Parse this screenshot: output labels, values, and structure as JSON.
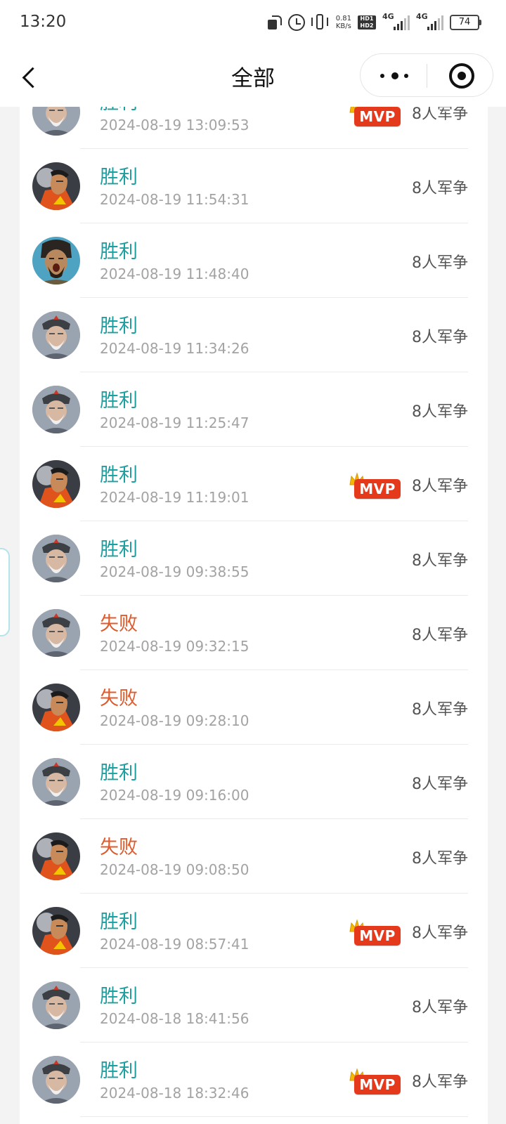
{
  "status_bar": {
    "time": "13:20",
    "net_speed": "0.81",
    "net_speed_unit": "KB/s",
    "hd_label_1": "HD1",
    "hd_label_2": "HD2",
    "network_1": "4G",
    "network_2": "4G",
    "battery": "74"
  },
  "nav": {
    "title": "全部",
    "back_icon": "chevron-left-icon",
    "more_icon": "more-dots-icon",
    "close_icon": "target-icon"
  },
  "mvp_label": "MVP",
  "records": [
    {
      "result": "胜利",
      "outcome": "win",
      "time": "2024-08-19 13:09:53",
      "mvp": true,
      "mode": "8人军争",
      "avatar": "old-general"
    },
    {
      "result": "胜利",
      "outcome": "win",
      "time": "2024-08-19 11:54:31",
      "mvp": false,
      "mode": "8人军争",
      "avatar": "red-armor-general"
    },
    {
      "result": "胜利",
      "outcome": "win",
      "time": "2024-08-19 11:48:40",
      "mvp": false,
      "mode": "8人军争",
      "avatar": "roaring-warrior"
    },
    {
      "result": "胜利",
      "outcome": "win",
      "time": "2024-08-19 11:34:26",
      "mvp": false,
      "mode": "8人军争",
      "avatar": "old-general"
    },
    {
      "result": "胜利",
      "outcome": "win",
      "time": "2024-08-19 11:25:47",
      "mvp": false,
      "mode": "8人军争",
      "avatar": "old-general"
    },
    {
      "result": "胜利",
      "outcome": "win",
      "time": "2024-08-19 11:19:01",
      "mvp": true,
      "mode": "8人军争",
      "avatar": "red-armor-general"
    },
    {
      "result": "胜利",
      "outcome": "win",
      "time": "2024-08-19 09:38:55",
      "mvp": false,
      "mode": "8人军争",
      "avatar": "old-general"
    },
    {
      "result": "失败",
      "outcome": "lose",
      "time": "2024-08-19 09:32:15",
      "mvp": false,
      "mode": "8人军争",
      "avatar": "old-general"
    },
    {
      "result": "失败",
      "outcome": "lose",
      "time": "2024-08-19 09:28:10",
      "mvp": false,
      "mode": "8人军争",
      "avatar": "red-armor-general"
    },
    {
      "result": "胜利",
      "outcome": "win",
      "time": "2024-08-19 09:16:00",
      "mvp": false,
      "mode": "8人军争",
      "avatar": "old-general"
    },
    {
      "result": "失败",
      "outcome": "lose",
      "time": "2024-08-19 09:08:50",
      "mvp": false,
      "mode": "8人军争",
      "avatar": "red-armor-general"
    },
    {
      "result": "胜利",
      "outcome": "win",
      "time": "2024-08-19 08:57:41",
      "mvp": true,
      "mode": "8人军争",
      "avatar": "red-armor-general"
    },
    {
      "result": "胜利",
      "outcome": "win",
      "time": "2024-08-18 18:41:56",
      "mvp": false,
      "mode": "8人军争",
      "avatar": "old-general"
    },
    {
      "result": "胜利",
      "outcome": "win",
      "time": "2024-08-18 18:32:46",
      "mvp": true,
      "mode": "8人军争",
      "avatar": "old-general"
    }
  ],
  "colors": {
    "win": "#1d9fa0",
    "lose": "#e05a2b",
    "mvp_badge": "#e5391c",
    "crown": "#f5b800"
  }
}
